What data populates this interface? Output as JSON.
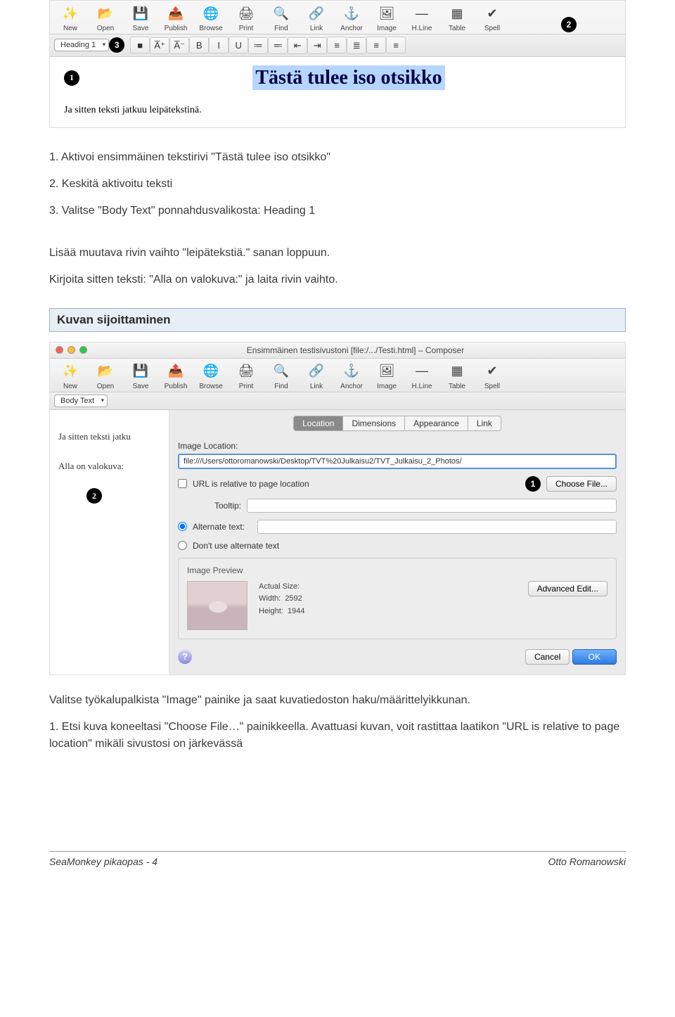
{
  "shot1": {
    "toolbar": [
      {
        "label": "New",
        "icon": "✨",
        "name": "new-button"
      },
      {
        "label": "Open",
        "icon": "📂",
        "name": "open-button"
      },
      {
        "label": "Save",
        "icon": "💾",
        "name": "save-button"
      },
      {
        "label": "Publish",
        "icon": "📤",
        "name": "publish-button"
      },
      {
        "label": "Browse",
        "icon": "🌐",
        "name": "browse-button"
      },
      {
        "label": "Print",
        "icon": "🖨",
        "name": "print-button"
      },
      {
        "label": "Find",
        "icon": "🔍",
        "name": "find-button"
      },
      {
        "label": "Link",
        "icon": "🔗",
        "name": "link-button"
      },
      {
        "label": "Anchor",
        "icon": "⚓",
        "name": "anchor-button"
      },
      {
        "label": "Image",
        "icon": "🖼",
        "name": "image-button"
      },
      {
        "label": "H.Line",
        "icon": "—",
        "name": "hline-button"
      },
      {
        "label": "Table",
        "icon": "▦",
        "name": "table-button"
      },
      {
        "label": "Spell",
        "icon": "✔",
        "name": "spell-button"
      }
    ],
    "style_select": "Heading 1",
    "fmt_buttons": [
      "■",
      "A̅⁺",
      "A̅⁻",
      "B",
      "I",
      "U",
      "≔",
      "≕",
      "⇤",
      "⇥",
      "≡",
      "≣",
      "≡",
      "≡"
    ],
    "heading_text": "Tästä tulee iso otsikko",
    "body_text": "Ja sitten teksti jatkuu leipätekstinä.",
    "markers": {
      "m1": "1",
      "m2": "2",
      "m3": "3"
    }
  },
  "para1_items": [
    "1. Aktivoi ensimmäinen tekstirivi \"Tästä tulee iso otsikko\"",
    "2. Keskitä aktivoitu teksti",
    "3. Valitse \"Body Text\" ponnahdusvalikosta: Heading 1"
  ],
  "para2": "Lisää muutava rivin vaihto \"leipätekstiä.\" sanan loppuun.",
  "para3": "Kirjoita sitten teksti: \"Alla on valokuva:\" ja laita rivin vaihto.",
  "section_title": "Kuvan sijoittaminen",
  "shot2": {
    "window_title": "Ensimmäinen testisivustoni [file:/.../Testi.html] – Composer",
    "toolbar": [
      {
        "label": "New",
        "icon": "✨",
        "name": "new-button"
      },
      {
        "label": "Open",
        "icon": "📂",
        "name": "open-button"
      },
      {
        "label": "Save",
        "icon": "💾",
        "name": "save-button"
      },
      {
        "label": "Publish",
        "icon": "📤",
        "name": "publish-button"
      },
      {
        "label": "Browse",
        "icon": "🌐",
        "name": "browse-button"
      },
      {
        "label": "Print",
        "icon": "🖨",
        "name": "print-button"
      },
      {
        "label": "Find",
        "icon": "🔍",
        "name": "find-button"
      },
      {
        "label": "Link",
        "icon": "🔗",
        "name": "link-button"
      },
      {
        "label": "Anchor",
        "icon": "⚓",
        "name": "anchor-button"
      },
      {
        "label": "Image",
        "icon": "🖼",
        "name": "image-button"
      },
      {
        "label": "H.Line",
        "icon": "—",
        "name": "hline-button"
      },
      {
        "label": "Table",
        "icon": "▦",
        "name": "table-button"
      },
      {
        "label": "Spell",
        "icon": "✔",
        "name": "spell-button"
      }
    ],
    "style_select": "Body Text",
    "doc_line1": "Ja sitten teksti jatku",
    "doc_line2": "Alla on valokuva:",
    "dlg": {
      "tabs": [
        "Location",
        "Dimensions",
        "Appearance",
        "Link"
      ],
      "active_tab": 0,
      "loc_label": "Image Location:",
      "loc_value": "file:///Users/ottoromanowski/Desktop/TVT%20Julkaisu2/TVT_Julkaisu_2_Photos/",
      "url_rel": "URL is relative to page location",
      "choose_file": "Choose File...",
      "tooltip_label": "Tooltip:",
      "alt_label": "Alternate text:",
      "noalt_label": "Don't use alternate text",
      "preview_legend": "Image Preview",
      "actual_size": "Actual Size:",
      "width_label": "Width:",
      "width_val": "2592",
      "height_label": "Height:",
      "height_val": "1944",
      "adv_edit": "Advanced Edit...",
      "cancel": "Cancel",
      "ok": "OK",
      "m1": "1",
      "m2": "2"
    }
  },
  "para4": "Valitse työkalupalkista \"Image\" painike ja saat kuvatiedoston haku/määrittelyikkunan.",
  "para5": "1. Etsi kuva koneeltasi \"Choose File…\" painikkeella. Avattuasi kuvan, voit rastittaa laatikon \"URL is relative to page location\" mikäli sivustosi on järkevässä",
  "footer_left": "SeaMonkey pikaopas - 4",
  "footer_right": "Otto Romanowski"
}
